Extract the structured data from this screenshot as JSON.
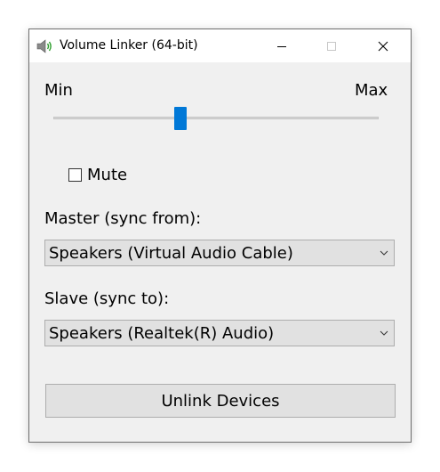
{
  "window": {
    "title": "Volume Linker (64-bit)",
    "icon": "speaker-icon"
  },
  "titlebar_buttons": [
    "minimize-icon",
    "maximize-icon",
    "close-icon"
  ],
  "slider": {
    "min_label": "Min",
    "max_label": "Max",
    "value_fraction": 0.39,
    "accent_color": "#0078d7"
  },
  "mute": {
    "label": "Mute",
    "checked": false
  },
  "master": {
    "label": "Master (sync from):",
    "selected": "Speakers (Virtual Audio Cable)"
  },
  "slave": {
    "label": "Slave (sync to):",
    "selected": "Speakers (Realtek(R) Audio)"
  },
  "action_button": {
    "label": "Unlink Devices"
  }
}
